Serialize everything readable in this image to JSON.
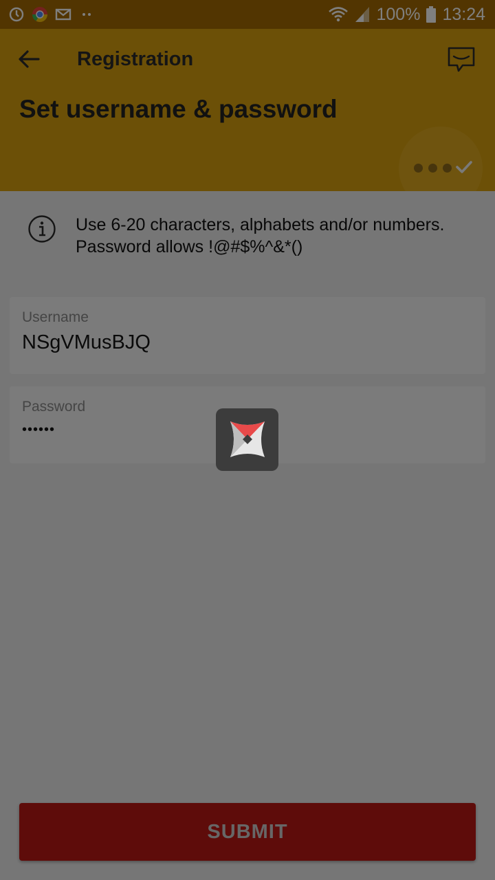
{
  "status_bar": {
    "battery": "100%",
    "time": "13:24",
    "icons": [
      "sync-icon",
      "chrome-icon",
      "gmail-icon",
      "notification-dots-icon",
      "wifi-icon",
      "signal-icon",
      "battery-icon"
    ]
  },
  "header": {
    "title": "Registration",
    "heading": "Set username & password",
    "back_icon": "arrow-left-icon",
    "chat_icon": "chat-bubble-icon",
    "progress_icon": "dots-check-icon",
    "color": "#d9a00f"
  },
  "info": {
    "text": "Use 6-20 characters, alphabets and/or numbers. Password allows !@#$%^&*()",
    "icon": "info-icon"
  },
  "form": {
    "username": {
      "label": "Username",
      "value": "NSgVMusBJQ"
    },
    "password": {
      "label": "Password",
      "value": "••••••"
    }
  },
  "submit": {
    "label": "SUBMIT",
    "color": "#bc1914"
  },
  "loading": {
    "icon": "app-logo-spinner-icon"
  }
}
